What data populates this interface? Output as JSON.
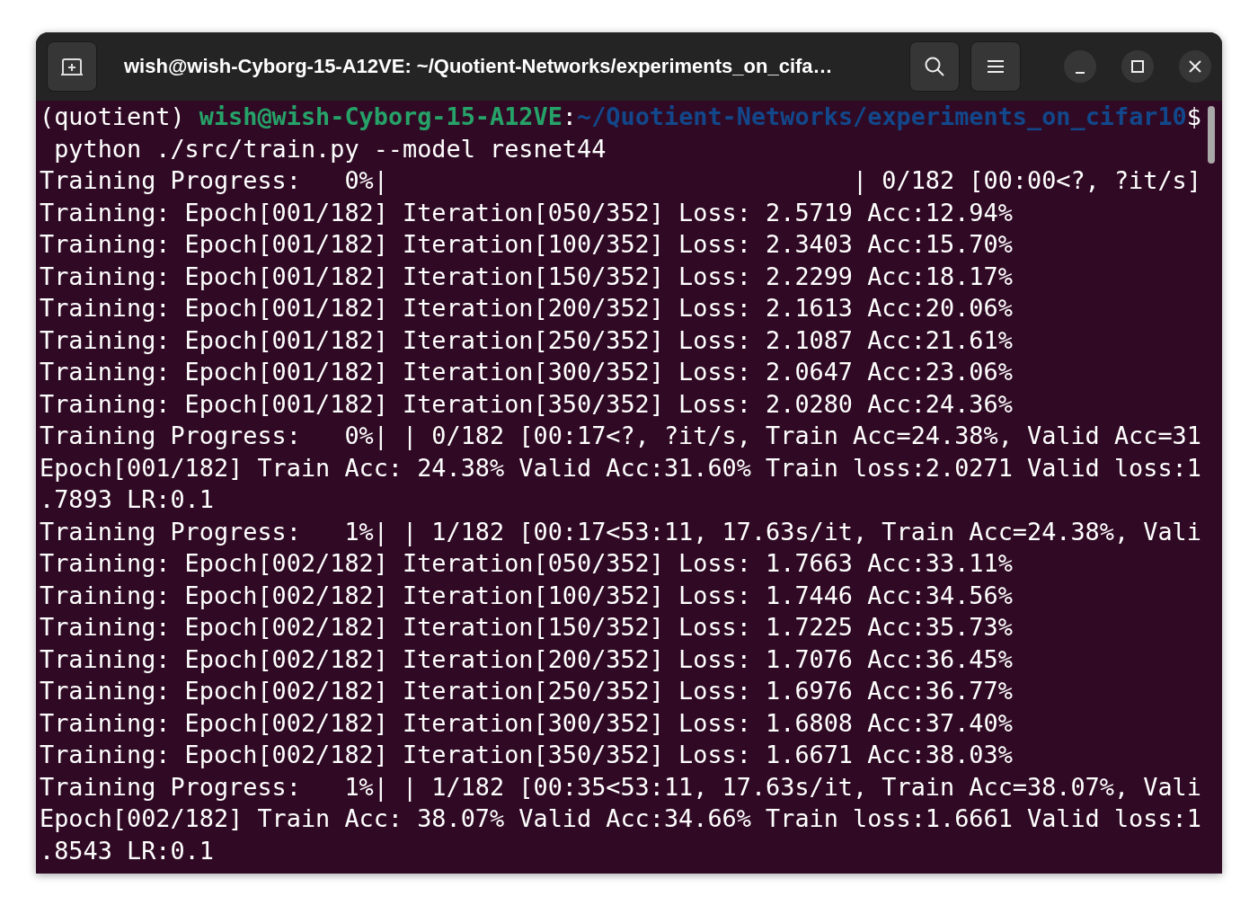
{
  "window": {
    "title": "wish@wish-Cyborg-15-A12VE: ~/Quotient-Networks/experiments_on_cifa…"
  },
  "terminal": {
    "lines": [
      {
        "segments": [
          {
            "kind": "env",
            "text": "(quotient) "
          },
          {
            "kind": "userhost",
            "text": "wish@wish-Cyborg-15-A12VE"
          },
          {
            "kind": "plain",
            "text": ":"
          },
          {
            "kind": "path",
            "text": "~/Quotient-Networks/experiments_on_cifar10"
          },
          {
            "kind": "plain",
            "text": "$"
          }
        ]
      },
      {
        "text": " python ./src/train.py --model resnet44"
      },
      {
        "text": "Training Progress:   0%|                                | 0/182 [00:00<?, ?it/s]"
      },
      {
        "text": "Training: Epoch[001/182] Iteration[050/352] Loss: 2.5719 Acc:12.94%"
      },
      {
        "text": "Training: Epoch[001/182] Iteration[100/352] Loss: 2.3403 Acc:15.70%"
      },
      {
        "text": "Training: Epoch[001/182] Iteration[150/352] Loss: 2.2299 Acc:18.17%"
      },
      {
        "text": "Training: Epoch[001/182] Iteration[200/352] Loss: 2.1613 Acc:20.06%"
      },
      {
        "text": "Training: Epoch[001/182] Iteration[250/352] Loss: 2.1087 Acc:21.61%"
      },
      {
        "text": "Training: Epoch[001/182] Iteration[300/352] Loss: 2.0647 Acc:23.06%"
      },
      {
        "text": "Training: Epoch[001/182] Iteration[350/352] Loss: 2.0280 Acc:24.36%"
      },
      {
        "text": "Training Progress:   0%| | 0/182 [00:17<?, ?it/s, Train Acc=24.38%, Valid Acc=31"
      },
      {
        "text": "Epoch[001/182] Train Acc: 24.38% Valid Acc:31.60% Train loss:2.0271 Valid loss:1"
      },
      {
        "text": ".7893 LR:0.1"
      },
      {
        "text": "Training Progress:   1%| | 1/182 [00:17<53:11, 17.63s/it, Train Acc=24.38%, Vali"
      },
      {
        "text": "Training: Epoch[002/182] Iteration[050/352] Loss: 1.7663 Acc:33.11%"
      },
      {
        "text": "Training: Epoch[002/182] Iteration[100/352] Loss: 1.7446 Acc:34.56%"
      },
      {
        "text": "Training: Epoch[002/182] Iteration[150/352] Loss: 1.7225 Acc:35.73%"
      },
      {
        "text": "Training: Epoch[002/182] Iteration[200/352] Loss: 1.7076 Acc:36.45%"
      },
      {
        "text": "Training: Epoch[002/182] Iteration[250/352] Loss: 1.6976 Acc:36.77%"
      },
      {
        "text": "Training: Epoch[002/182] Iteration[300/352] Loss: 1.6808 Acc:37.40%"
      },
      {
        "text": "Training: Epoch[002/182] Iteration[350/352] Loss: 1.6671 Acc:38.03%"
      },
      {
        "text": "Training Progress:   1%| | 1/182 [00:35<53:11, 17.63s/it, Train Acc=38.07%, Vali"
      },
      {
        "text": "Epoch[002/182] Train Acc: 38.07% Valid Acc:34.66% Train loss:1.6661 Valid loss:1"
      },
      {
        "text": ".8543 LR:0.1"
      }
    ]
  }
}
